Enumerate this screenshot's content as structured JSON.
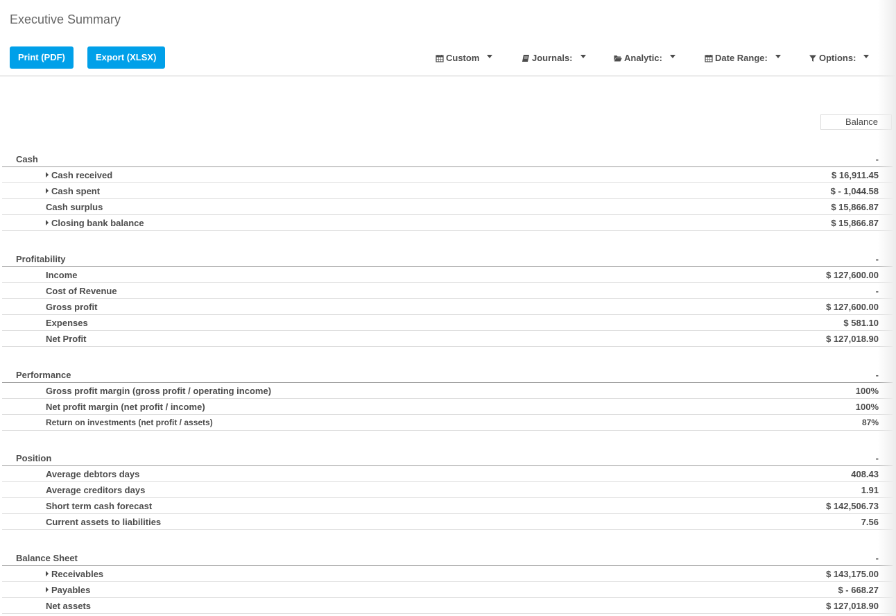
{
  "page": {
    "title": "Executive Summary"
  },
  "toolbar": {
    "print_label": "Print (PDF)",
    "export_label": "Export (XLSX)",
    "filters": {
      "custom": "Custom",
      "journals": "Journals:",
      "analytic": "Analytic:",
      "date_range": "Date Range:",
      "options": "Options:"
    }
  },
  "report": {
    "column_header": "Balance",
    "sections": [
      {
        "title": "Cash",
        "value": "-",
        "rows": [
          {
            "label": "Cash received",
            "value": "$ 16,911.45",
            "expandable": true
          },
          {
            "label": "Cash spent",
            "value": "$ - 1,044.58",
            "expandable": true
          },
          {
            "label": "Cash surplus",
            "value": "$ 15,866.87",
            "expandable": false
          },
          {
            "label": "Closing bank balance",
            "value": "$ 15,866.87",
            "expandable": true
          }
        ]
      },
      {
        "title": "Profitability",
        "value": "-",
        "rows": [
          {
            "label": "Income",
            "value": "$ 127,600.00",
            "expandable": false
          },
          {
            "label": "Cost of Revenue",
            "value": "-",
            "expandable": false
          },
          {
            "label": "Gross profit",
            "value": "$ 127,600.00",
            "expandable": false
          },
          {
            "label": "Expenses",
            "value": "$ 581.10",
            "expandable": false
          },
          {
            "label": "Net Profit",
            "value": "$ 127,018.90",
            "expandable": false
          }
        ]
      },
      {
        "title": "Performance",
        "value": "-",
        "rows": [
          {
            "label": "Gross profit margin (gross profit / operating income)",
            "value": "100%",
            "expandable": false
          },
          {
            "label": "Net profit margin (net profit / income)",
            "value": "100%",
            "expandable": false
          },
          {
            "label": "Return on investments (net profit / assets)",
            "value": "87%",
            "expandable": false
          }
        ]
      },
      {
        "title": "Position",
        "value": "-",
        "rows": [
          {
            "label": "Average debtors days",
            "value": "408.43",
            "expandable": false
          },
          {
            "label": "Average creditors days",
            "value": "1.91",
            "expandable": false
          },
          {
            "label": "Short term cash forecast",
            "value": "$ 142,506.73",
            "expandable": false
          },
          {
            "label": "Current assets to liabilities",
            "value": "7.56",
            "expandable": false
          }
        ]
      },
      {
        "title": "Balance Sheet",
        "value": "-",
        "rows": [
          {
            "label": "Receivables",
            "value": "$ 143,175.00",
            "expandable": true
          },
          {
            "label": "Payables",
            "value": "$ - 668.27",
            "expandable": true
          },
          {
            "label": "Net assets",
            "value": "$ 127,018.90",
            "expandable": false
          }
        ]
      }
    ]
  },
  "icons": {
    "custom": "calendar-icon",
    "journals": "book-icon",
    "analytic": "folder-open-icon",
    "date_range": "calendar-icon",
    "options": "filter-icon",
    "expand": "caret-right-icon",
    "dropdown": "caret-down-icon"
  },
  "colors": {
    "accent": "#00a0e9",
    "text": "#4c4c4c"
  }
}
